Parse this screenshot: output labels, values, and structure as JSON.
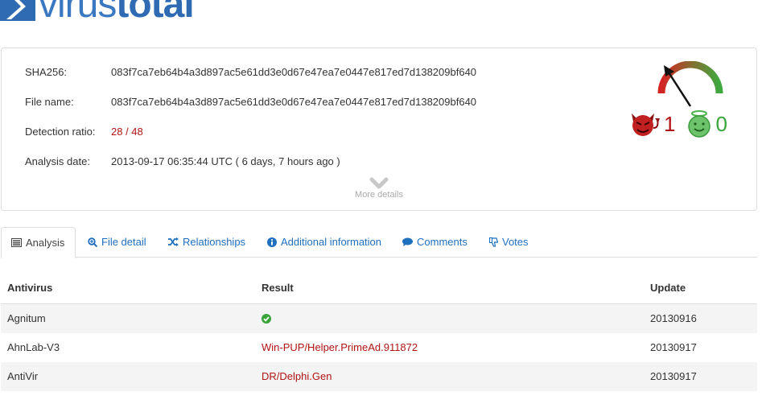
{
  "brand": {
    "name_part1": "virus",
    "name_part2": "total"
  },
  "summary": {
    "sha256_label": "SHA256:",
    "sha256_value": "083f7ca7eb64b4a3d897ac5e61dd3e0d67e47ea7e0447e817ed7d138209bf640",
    "filename_label": "File name:",
    "filename_value": "083f7ca7eb64b4a3d897ac5e61dd3e0d67e47ea7e0447e817ed7d138209bf640",
    "detection_label": "Detection ratio:",
    "detection_value": "28 / 48",
    "date_label": "Analysis date:",
    "date_value": "2013-09-17 06:35:44 UTC ( 6 days, 7 hours ago )",
    "more_details": "More details"
  },
  "community": {
    "bad_votes": "1",
    "good_votes": "0",
    "bad_icon": "devil-icon",
    "good_icon": "angel-icon",
    "gauge_icon": "score-gauge-icon"
  },
  "tabs": [
    {
      "label": "Analysis",
      "icon": "list-icon",
      "active": true
    },
    {
      "label": "File detail",
      "icon": "zoom-icon"
    },
    {
      "label": "Relationships",
      "icon": "shuffle-icon"
    },
    {
      "label": "Additional information",
      "icon": "info-icon"
    },
    {
      "label": "Comments",
      "icon": "comment-icon"
    },
    {
      "label": "Votes",
      "icon": "thumbs-down-icon"
    }
  ],
  "table": {
    "headers": [
      "Antivirus",
      "Result",
      "Update"
    ],
    "rows": [
      {
        "antivirus": "Agnitum",
        "result": "",
        "result_icon": "check-circle-icon",
        "update": "20130916"
      },
      {
        "antivirus": "AhnLab-V3",
        "result": "Win-PUP/Helper.PrimeAd.911872",
        "update": "20130917"
      },
      {
        "antivirus": "AntiVir",
        "result": "DR/Delphi.Gen",
        "update": "20130917"
      }
    ]
  },
  "colors": {
    "brand_blue": "#2e6bb3",
    "link_blue": "#1f6fbf",
    "detection_red": "#b01414",
    "clean_green": "#3aa33a"
  }
}
